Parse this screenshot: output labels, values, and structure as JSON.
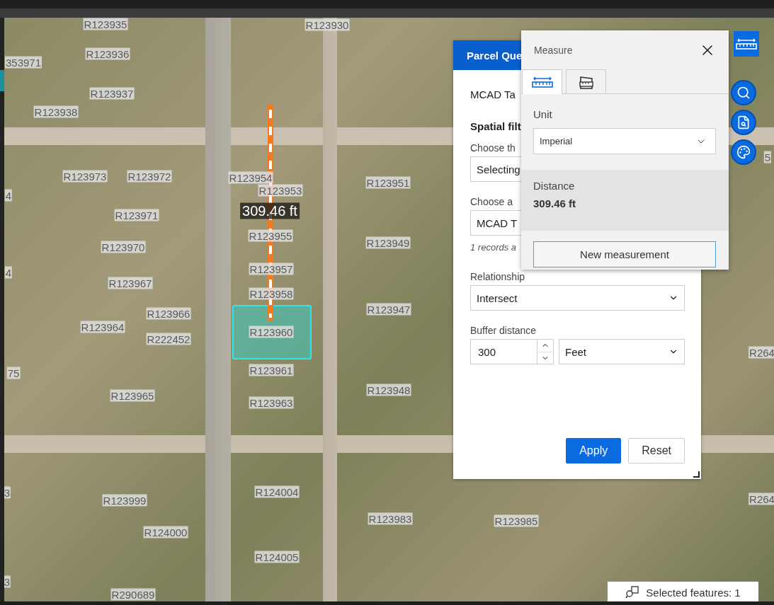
{
  "map": {
    "parcel_labels": [
      "R123935",
      "R123936",
      "353971",
      "R123937",
      "R123938",
      "R123930",
      "R123973",
      "R123972",
      "R123954",
      "R123953",
      "R123951",
      "R123971",
      "R123955",
      "R123949",
      "R123970",
      "R123957",
      "R123967",
      "R123958",
      "R123947",
      "R123966",
      "R123964",
      "R123960",
      "R222452",
      "R123961",
      "R123948",
      "R123965",
      "R123963",
      "R124004",
      "R123999",
      "R124000",
      "R123983",
      "R123985",
      "R124005",
      "R290689",
      "R264",
      "R264",
      "4",
      "4",
      "75",
      "5",
      "3",
      "3"
    ],
    "measurement_label": "309.46 ft"
  },
  "query_panel": {
    "title": "Parcel Que",
    "layer_heading": "MCAD Ta",
    "section_heading": "Spatial filt",
    "fields": [
      {
        "kind": "select",
        "label": "Choose th",
        "value": "Selecting"
      },
      {
        "kind": "select",
        "label": "Choose a",
        "value": "MCAD T",
        "note": "1 records a"
      },
      {
        "kind": "select",
        "label": "Relationship",
        "value": "Intersect"
      },
      {
        "kind": "buffer",
        "label": "Buffer distance",
        "value": "300",
        "unit": "Feet"
      }
    ],
    "buttons": [
      {
        "label": "Apply",
        "kind": "primary"
      },
      {
        "label": "Reset",
        "kind": "secondary"
      }
    ]
  },
  "measure_widget": {
    "title": "Measure",
    "tabs": [
      {
        "kind": "distance",
        "selected": true
      },
      {
        "kind": "area",
        "selected": false
      }
    ],
    "unit_label": "Unit",
    "unit_value": "Imperial",
    "result_label": "Distance",
    "result_value": "309.46 ft",
    "button": "New measurement"
  },
  "map_tools": [
    {
      "kind": "measure"
    },
    {
      "kind": "query"
    },
    {
      "kind": "query-list"
    },
    {
      "kind": "style"
    }
  ],
  "status": {
    "text": "Selected features: 1"
  }
}
